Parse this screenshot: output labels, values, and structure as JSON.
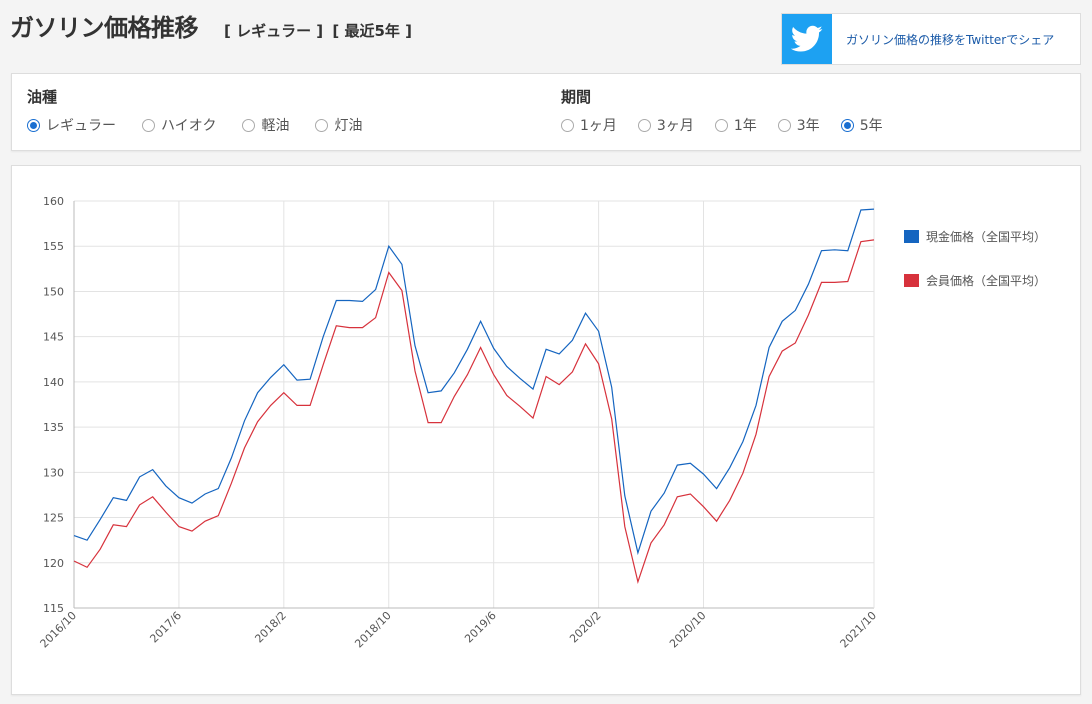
{
  "header": {
    "title": "ガソリン価格推移",
    "fuel_tag": "[ レギュラー ]",
    "period_tag": "[ 最近5年 ]"
  },
  "share": {
    "icon": "twitter-icon",
    "label": "ガソリン価格の推移をTwitterでシェア",
    "color": "#1da1f2"
  },
  "filters": {
    "fuel": {
      "label": "油種",
      "options": [
        {
          "label": "レギュラー",
          "checked": true
        },
        {
          "label": "ハイオク",
          "checked": false
        },
        {
          "label": "軽油",
          "checked": false
        },
        {
          "label": "灯油",
          "checked": false
        }
      ]
    },
    "period": {
      "label": "期間",
      "options": [
        {
          "label": "1ヶ月",
          "checked": false
        },
        {
          "label": "3ヶ月",
          "checked": false
        },
        {
          "label": "1年",
          "checked": false
        },
        {
          "label": "3年",
          "checked": false
        },
        {
          "label": "5年",
          "checked": true
        }
      ]
    }
  },
  "chart_data": {
    "type": "line",
    "ylim": [
      115,
      160
    ],
    "yticks": [
      115,
      120,
      125,
      130,
      135,
      140,
      145,
      150,
      155,
      160
    ],
    "x_count": 62,
    "xtick_labels": [
      {
        "index": 0,
        "label": "2016/10"
      },
      {
        "index": 8,
        "label": "2017/6"
      },
      {
        "index": 16,
        "label": "2018/2"
      },
      {
        "index": 24,
        "label": "2018/10"
      },
      {
        "index": 32,
        "label": "2019/6"
      },
      {
        "index": 40,
        "label": "2020/2"
      },
      {
        "index": 48,
        "label": "2020/10"
      },
      {
        "index": 61,
        "label": "2021/10"
      }
    ],
    "grid": true,
    "legend_position": "right",
    "series": [
      {
        "name": "現金価格（全国平均）",
        "color": "#1565c0",
        "values": [
          123.0,
          122.5,
          124.8,
          127.2,
          126.9,
          129.5,
          130.3,
          128.5,
          127.2,
          126.6,
          127.6,
          128.2,
          131.6,
          135.7,
          138.8,
          140.5,
          141.9,
          140.2,
          140.3,
          145.0,
          149.0,
          149.0,
          148.9,
          150.2,
          155.0,
          153.0,
          144.0,
          138.8,
          139.0,
          141.0,
          143.6,
          146.7,
          143.7,
          141.7,
          140.4,
          139.2,
          143.6,
          143.1,
          144.6,
          147.6,
          145.6,
          139.4,
          127.4,
          121.1,
          125.7,
          127.7,
          130.8,
          131.0,
          129.8,
          128.2,
          130.5,
          133.4,
          137.4,
          143.8,
          146.7,
          147.9,
          150.8,
          154.5,
          154.6,
          154.5,
          159.0,
          159.1
        ]
      },
      {
        "name": "会員価格（全国平均）",
        "color": "#d7323c",
        "values": [
          120.2,
          119.5,
          121.5,
          124.2,
          124.0,
          126.4,
          127.3,
          125.6,
          124.0,
          123.5,
          124.6,
          125.2,
          128.8,
          132.7,
          135.6,
          137.4,
          138.8,
          137.4,
          137.4,
          141.9,
          146.2,
          146.0,
          146.0,
          147.1,
          152.1,
          150.1,
          141.2,
          135.5,
          135.5,
          138.4,
          140.8,
          143.8,
          140.8,
          138.5,
          137.3,
          136.0,
          140.6,
          139.7,
          141.1,
          144.2,
          142.0,
          135.9,
          124.0,
          117.9,
          122.2,
          124.2,
          127.3,
          127.6,
          126.2,
          124.6,
          126.9,
          129.9,
          134.2,
          140.6,
          143.4,
          144.3,
          147.4,
          151.0,
          151.0,
          151.1,
          155.5,
          155.7
        ]
      }
    ]
  }
}
